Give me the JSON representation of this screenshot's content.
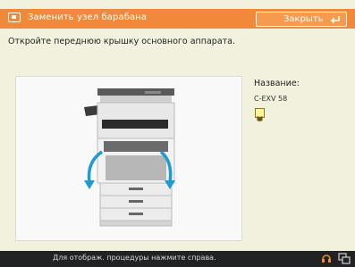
{
  "title_bar": {
    "title": "Заменить узел барабана",
    "close_label": "Закрыть",
    "accent_color": "#f08a3a",
    "icon": "replace-part-icon",
    "close_icon": "return-arrow-icon"
  },
  "instruction": "Откройте переднюю крышку основного аппарата.",
  "illustration": {
    "subject": "printer-open-front-cover",
    "arrow_color": "#1e9bd0"
  },
  "info": {
    "label": "Название:",
    "value": "C-EXV 58",
    "help_icon": "help-book-icon"
  },
  "bottom_bar": {
    "text": "Для отображ. процедуры нажмите  справа.",
    "help_icon": "headset-help-icon",
    "screen_icon": "screen-switch-icon"
  }
}
